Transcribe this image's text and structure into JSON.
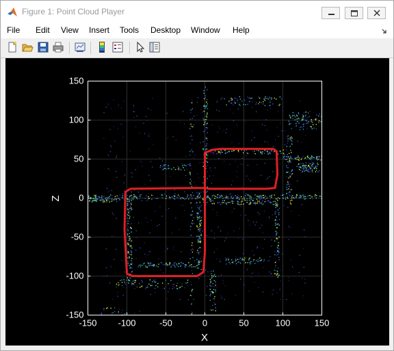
{
  "window": {
    "title": "Figure 1: Point Cloud Player"
  },
  "menubar": {
    "items": [
      "File",
      "Edit",
      "View",
      "Insert",
      "Tools",
      "Desktop",
      "Window",
      "Help"
    ]
  },
  "toolbar": {
    "buttons": [
      "new-figure-icon",
      "open-file-icon",
      "save-icon",
      "print-icon",
      "link-plot-icon",
      "colorbar-icon",
      "legend-icon",
      "pointer-icon",
      "property-inspector-icon"
    ]
  },
  "chart_data": {
    "type": "scatter",
    "xlabel": "X",
    "ylabel": "Z",
    "xlim": [
      -150,
      150
    ],
    "ylim": [
      -150,
      150
    ],
    "xticks": [
      -150,
      -100,
      -50,
      0,
      50,
      100,
      150
    ],
    "yticks": [
      -150,
      -100,
      -50,
      0,
      50,
      100,
      150
    ],
    "grid": true,
    "background": "#000000",
    "axis_color": "#ffffff",
    "pointcloud_colors": [
      "#3a1e80",
      "#3b62c8",
      "#2fa5cf",
      "#44d3b0",
      "#e6e622"
    ],
    "trajectory_color": "#e01f26",
    "trajectory": {
      "x": [
        0,
        -95,
        -102,
        -103,
        -100,
        -92,
        -10,
        -2,
        0,
        0,
        0,
        10,
        20,
        88,
        92,
        93,
        90,
        80,
        5,
        0
      ],
      "z": [
        13,
        12,
        8,
        -40,
        -97,
        -100,
        -100,
        -95,
        -70,
        0,
        58,
        62,
        63,
        63,
        60,
        30,
        13,
        12,
        12,
        13
      ]
    }
  }
}
